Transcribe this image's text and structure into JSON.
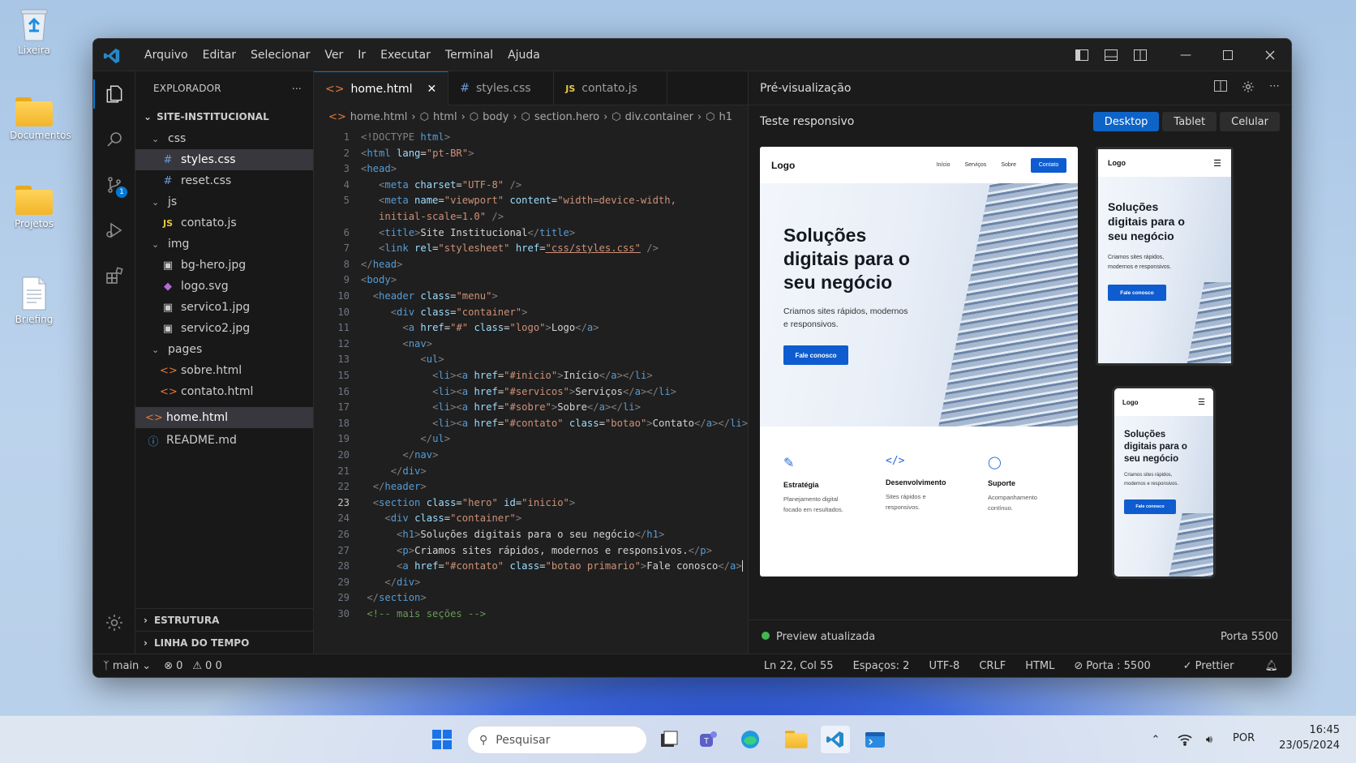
{
  "desktop": {
    "icons": [
      {
        "label": "Lixeira"
      },
      {
        "label": "Documentos"
      },
      {
        "label": "Projetos"
      },
      {
        "label": "Briefing"
      }
    ]
  },
  "menu": [
    "Arquivo",
    "Editar",
    "Selecionar",
    "Ver",
    "Ir",
    "Executar",
    "Terminal",
    "Ajuda"
  ],
  "explorer": {
    "title": "EXPLORADOR",
    "root": "SITE-INSTITUCIONAL",
    "items": [
      {
        "label": "css",
        "kind": "folder"
      },
      {
        "label": "styles.css",
        "kind": "css"
      },
      {
        "label": "reset.css",
        "kind": "css"
      },
      {
        "label": "js",
        "kind": "folder"
      },
      {
        "label": "contato.js",
        "kind": "js"
      },
      {
        "label": "img",
        "kind": "folder"
      },
      {
        "label": "bg-hero.jpg",
        "kind": "img"
      },
      {
        "label": "logo.svg",
        "kind": "svg"
      },
      {
        "label": "servico1.jpg",
        "kind": "img"
      },
      {
        "label": "servico2.jpg",
        "kind": "img"
      },
      {
        "label": "pages",
        "kind": "folder"
      },
      {
        "label": "sobre.html",
        "kind": "html"
      },
      {
        "label": "contato.html",
        "kind": "html"
      },
      {
        "label": "home.html",
        "kind": "html"
      },
      {
        "label": "README.md",
        "kind": "info"
      }
    ],
    "sections": [
      "ESTRUTURA",
      "LINHA DO TEMPO"
    ]
  },
  "tabs": [
    {
      "label": "home.html",
      "icon": "<>"
    },
    {
      "label": "styles.css",
      "icon": "#"
    },
    {
      "label": "contato.js",
      "icon": "JS"
    }
  ],
  "breadcrumb": [
    "home.html",
    "html",
    "body",
    "section.hero",
    "div.container",
    "h1"
  ],
  "line_numbers": [
    "1",
    "2",
    "3",
    "4",
    "5",
    "",
    "6",
    "7",
    "8",
    "9",
    "10",
    "10",
    "11",
    "12",
    "13",
    "15",
    "16",
    "17",
    "18",
    "19",
    "20",
    "21",
    "22",
    "23",
    "24",
    "26",
    "27",
    "28",
    "29",
    "29",
    "30"
  ],
  "preview": {
    "title": "Pré-visualização",
    "subtitle": "Teste responsivo",
    "modes": [
      "Desktop",
      "Tablet",
      "Celular"
    ],
    "active_mode": "Desktop",
    "status": "Preview atualizada",
    "port": "Porta 5500"
  },
  "site": {
    "logo": "Logo",
    "nav": [
      "Início",
      "Serviços",
      "Sobre"
    ],
    "nav_cta": "Contato",
    "headline_lines": [
      "Soluções",
      "digitais para o",
      "seu negócio"
    ],
    "lead_lines": [
      "Criamos sites rápidos, modernos",
      "e responsivos."
    ],
    "tablet_lead_lines": [
      "Criamos sites rápidos,",
      "modernos e responsivos."
    ],
    "cta": "Fale conosco",
    "features": [
      {
        "title": "Estratégia",
        "lines": [
          "Planejamento digital",
          "focado em resultados."
        ]
      },
      {
        "title": "Desenvolvimento",
        "lines": [
          "Sites rápidos e",
          "responsivos."
        ]
      },
      {
        "title": "Suporte",
        "lines": [
          "Acompanhamento",
          "contínuo."
        ]
      }
    ],
    "menu_icon": "☰"
  },
  "statusbar": {
    "branch": "main",
    "errors": "0",
    "warnings": "0 0",
    "position": "Ln 22, Col 55",
    "spaces": "Espaços: 2",
    "encoding": "UTF-8",
    "eol": "CRLF",
    "language": "HTML",
    "port": "Porta : 5500",
    "formatter": "Prettier"
  },
  "taskbar": {
    "search_placeholder": "Pesquisar",
    "lang": "POR",
    "time": "16:45",
    "date": "23/05/2024"
  },
  "colors": {
    "accent": "#0078d4",
    "tag": "#569cd6",
    "attr": "#9cdcfe",
    "string": "#ce9178",
    "comment": "#6a9955",
    "site_blue": "#0e5ccf"
  }
}
